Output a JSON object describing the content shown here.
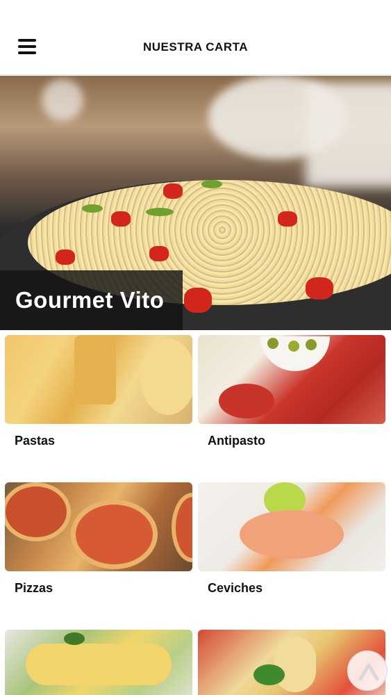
{
  "header": {
    "title": "NUESTRA CARTA",
    "menu_icon": "hamburger-menu-icon"
  },
  "hero": {
    "label": "Gourmet Vito"
  },
  "categories": [
    {
      "label": "Pastas"
    },
    {
      "label": "Antipasto"
    },
    {
      "label": "Pizzas"
    },
    {
      "label": "Ceviches"
    },
    {
      "label": ""
    },
    {
      "label": ""
    }
  ],
  "scroll_top_icon": "chevron-up-icon",
  "colors": {
    "header_bg": "#ffffff",
    "text": "#111111",
    "hero_label_bg": "#141414"
  }
}
